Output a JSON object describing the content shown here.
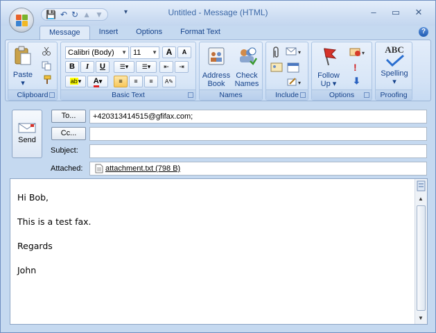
{
  "window": {
    "title": "Untitled - Message (HTML)",
    "minimize": "–",
    "maximize": "▭",
    "close": "✕"
  },
  "qat": {
    "save": "💾",
    "undo": "↶",
    "redo": "↻",
    "up": "▲",
    "down": "▼",
    "more": "▾"
  },
  "tabs": [
    "Message",
    "Insert",
    "Options",
    "Format Text"
  ],
  "help": "?",
  "ribbon": {
    "clipboard": {
      "label": "Clipboard",
      "paste": "Paste",
      "paste_arrow": "▾"
    },
    "basic_text": {
      "label": "Basic Text",
      "font": "Calibri (Body)",
      "size": "11",
      "grow": "A",
      "shrink": "A",
      "bold": "B",
      "italic": "I",
      "underline": "U",
      "highlight": "ab",
      "font_color": "A"
    },
    "names": {
      "label": "Names",
      "address_book_1": "Address",
      "address_book_2": "Book",
      "check_names_1": "Check",
      "check_names_2": "Names"
    },
    "include": {
      "label": "Include"
    },
    "options": {
      "label": "Options",
      "follow_up_1": "Follow",
      "follow_up_2": "Up ▾"
    },
    "proofing": {
      "label": "Proofing",
      "spelling": "Spelling",
      "spelling_arrow": "▾",
      "abc": "ABC"
    }
  },
  "compose": {
    "send": "Send",
    "to_button": "To...",
    "cc_button": "Cc...",
    "to_value": "+420313414515@gfifax.com;",
    "cc_value": "",
    "subject_label": "Subject:",
    "subject_value": "",
    "attached_label": "Attached:",
    "attachment": "attachment.txt (798 B)"
  },
  "body": {
    "lines": [
      "Hi Bob,",
      "This is a test fax.",
      "Regards",
      "John"
    ]
  },
  "colors": {
    "accent": "#15428b",
    "highlight": "#ffff00",
    "font_color": "#e02020"
  }
}
